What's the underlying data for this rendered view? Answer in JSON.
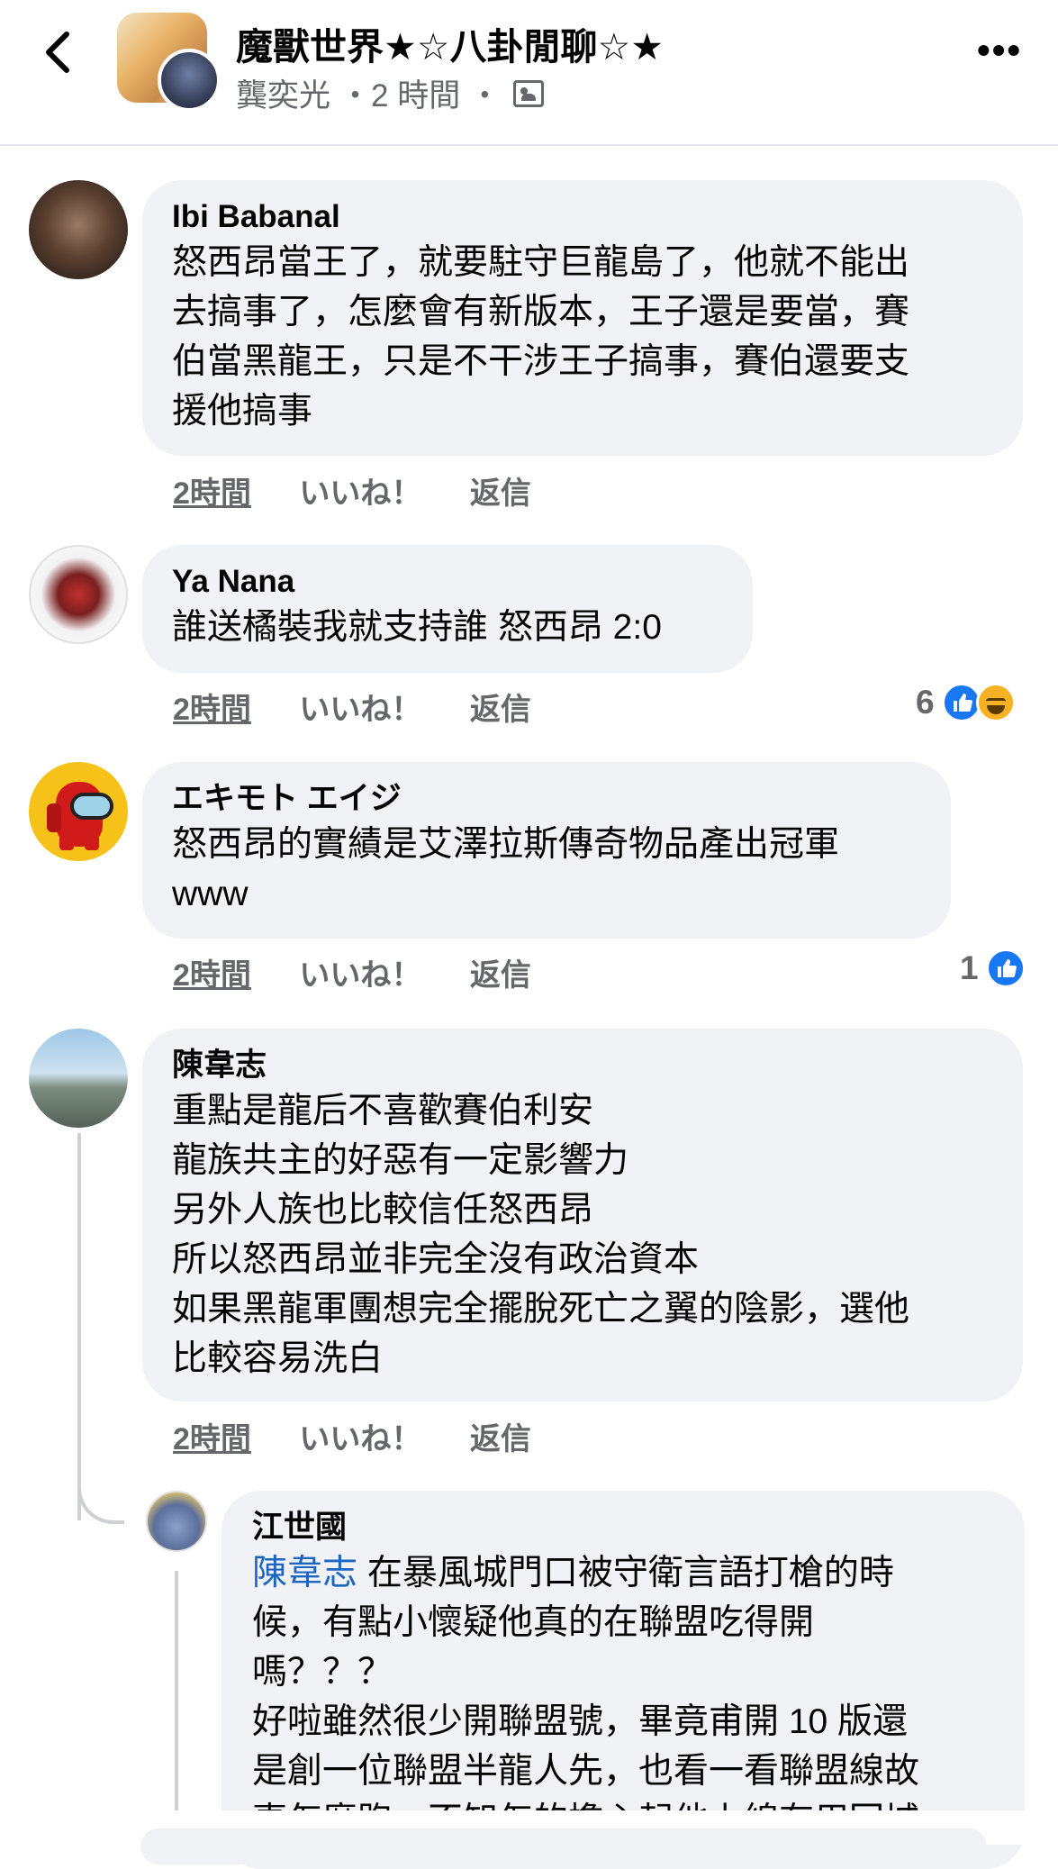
{
  "header": {
    "title": "魔獸世界★☆八卦閒聊☆★",
    "author": "龔奕光",
    "time": "・2 時間 ・",
    "privacy_icon": "group-icon"
  },
  "colors": {
    "bubble": "#f0f2f5",
    "secondary": "#65676b",
    "link": "#1d65c1",
    "like": "#1877f2"
  },
  "comments": [
    {
      "name": "Ibi Babanal",
      "lines": [
        "怒西昂當王了，就要駐守巨龍島了，他就不能出",
        "去搞事了，怎麼會有新版本，王子還是要當，賽",
        "伯當黑龍王，只是不干涉王子搞事，賽伯還要支",
        "援他搞事"
      ],
      "time": "2時間",
      "like": "いいね！",
      "reply": "返信"
    },
    {
      "name": "Ya Nana",
      "lines": [
        "誰送橘裝我就支持誰 怒西昂 2:0"
      ],
      "time": "2時間",
      "like": "いいね！",
      "reply": "返信",
      "reaction_count": "6"
    },
    {
      "name": "エキモト エイジ",
      "lines": [
        "怒西昂的實績是艾澤拉斯傳奇物品產出冠軍",
        "www"
      ],
      "time": "2時間",
      "like": "いいね！",
      "reply": "返信",
      "reaction_count": "1"
    },
    {
      "name": "陳韋志",
      "lines": [
        "重點是龍后不喜歡賽伯利安",
        "龍族共主的好惡有一定影響力",
        "另外人族也比較信任怒西昂",
        "所以怒西昂並非完全沒有政治資本",
        "如果黑龍軍團想完全擺脫死亡之翼的陰影，選他",
        "比較容易洗白"
      ],
      "time": "2時間",
      "like": "いいね！",
      "reply": "返信"
    }
  ],
  "reply": {
    "name": "江世國",
    "mention": "陳韋志",
    "first_line": " 在暴風城門口被守衛言語打槍的時",
    "lines": [
      "候，有點小懷疑他真的在聯盟吃得開",
      "嗎？？？",
      "好啦雖然很少開聯盟號，畢竟甫開 10 版還",
      "是創一位聯盟半龍人先，也看一看聯盟線故",
      "事怎麼跑，不知怎的擔心起他上線有用回城"
    ]
  }
}
